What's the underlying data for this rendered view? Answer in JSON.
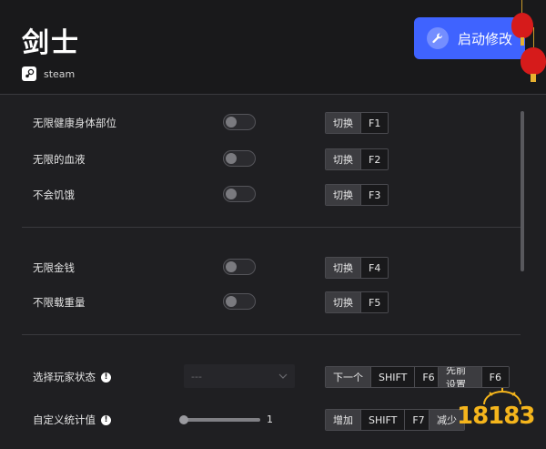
{
  "header": {
    "game_title": "剑士",
    "platform": "steam",
    "launch_label": "启动修改"
  },
  "cheats_group1": [
    {
      "label": "无限健康身体部位",
      "action": "切换",
      "key": "F1"
    },
    {
      "label": "无限的血液",
      "action": "切换",
      "key": "F2"
    },
    {
      "label": "不会饥饿",
      "action": "切换",
      "key": "F3"
    }
  ],
  "cheats_group2": [
    {
      "label": "无限金钱",
      "action": "切换",
      "key": "F4"
    },
    {
      "label": "不限载重量",
      "action": "切换",
      "key": "F5"
    }
  ],
  "player_state": {
    "label": "选择玩家状态",
    "select_value": "---",
    "next_action": "下一个",
    "next_mod": "SHIFT",
    "next_key": "F6",
    "prev_action": "先前设置",
    "prev_key": "F6"
  },
  "custom_stat": {
    "label": "自定义统计值",
    "slider_value": "1",
    "inc_action": "增加",
    "inc_mod": "SHIFT",
    "inc_key": "F7",
    "dec_action": "减少"
  },
  "watermark": "18183",
  "colors": {
    "accent": "#3f63ff",
    "background": "#1f1f22",
    "lantern": "#d61b1b",
    "watermark": "#f5b51c"
  }
}
